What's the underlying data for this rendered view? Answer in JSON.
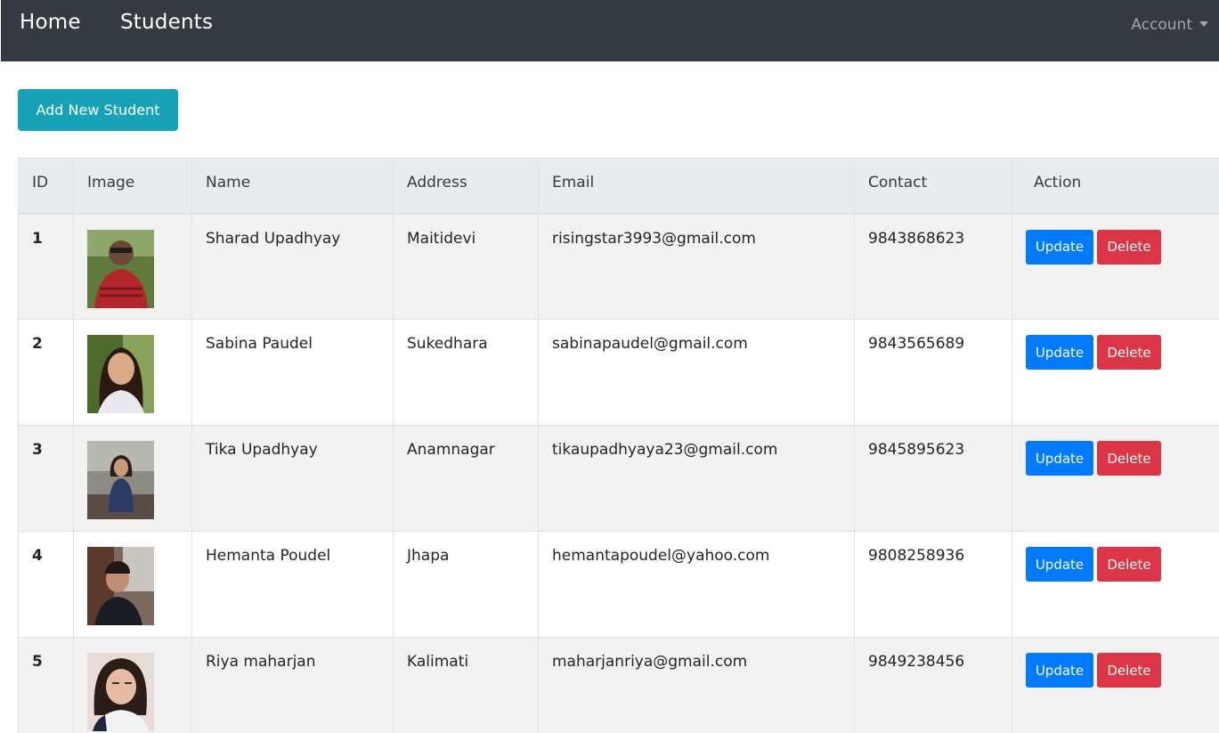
{
  "nav": {
    "home": "Home",
    "students": "Students",
    "account": "Account"
  },
  "add_button": "Add New Student",
  "table": {
    "headers": [
      "ID",
      "Image",
      "Name",
      "Address",
      "Email",
      "Contact",
      "Action"
    ],
    "rows": [
      {
        "id": "1",
        "name": "Sharad Upadhyay",
        "address": "Maitidevi",
        "email": "risingstar3993@gmail.com",
        "contact": "9843868623",
        "update": "Update",
        "delete": "Delete"
      },
      {
        "id": "2",
        "name": "Sabina Paudel",
        "address": "Sukedhara",
        "email": "sabinapaudel@gmail.com",
        "contact": "9843565689",
        "update": "Update",
        "delete": "Delete"
      },
      {
        "id": "3",
        "name": "Tika Upadhyay",
        "address": "Anamnagar",
        "email": "tikaupadhyaya23@gmail.com",
        "contact": "9845895623",
        "update": "Update",
        "delete": "Delete"
      },
      {
        "id": "4",
        "name": "Hemanta Poudel",
        "address": "Jhapa",
        "email": "hemantapoudel@yahoo.com",
        "contact": "9808258936",
        "update": "Update",
        "delete": "Delete"
      },
      {
        "id": "5",
        "name": "Riya maharjan",
        "address": "Kalimati",
        "email": "maharjanriya@gmail.com",
        "contact": "9849238456",
        "update": "Update",
        "delete": "Delete"
      }
    ]
  },
  "colors": {
    "navbar": "#343a40",
    "add_button": "#17a2b8",
    "update_button": "#007bff",
    "delete_button": "#dc3545"
  }
}
